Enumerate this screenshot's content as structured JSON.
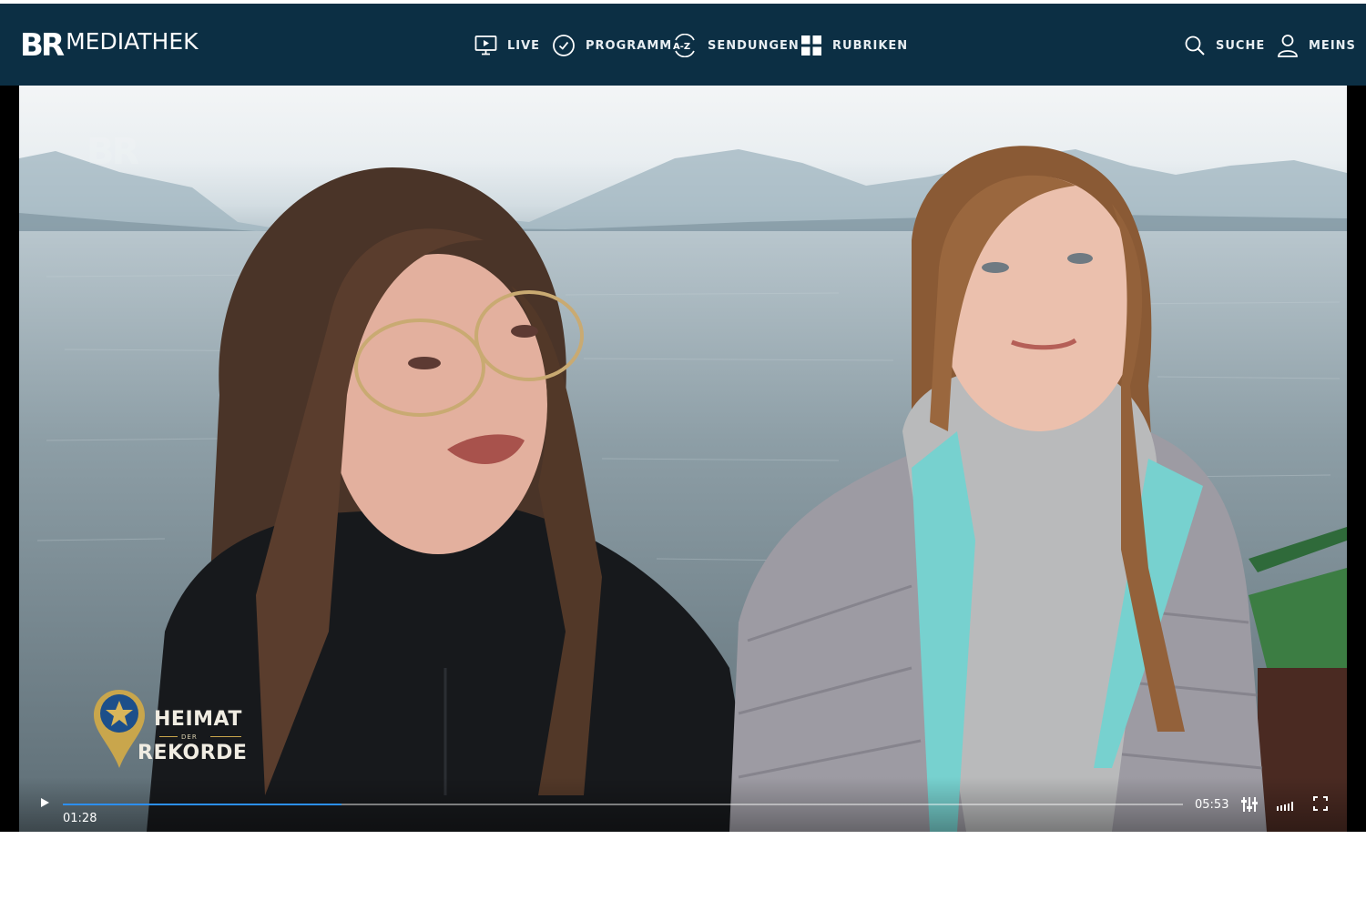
{
  "brand": {
    "logo_mark": "BR",
    "logo_text": "MEDIATHEK"
  },
  "nav": {
    "live": {
      "label": "LIVE",
      "icon": "tv-play-icon"
    },
    "programm": {
      "label": "PROGRAMM",
      "icon": "clock-icon"
    },
    "sendungen": {
      "label": "SENDUNGEN",
      "icon": "a-z-icon"
    },
    "rubriken": {
      "label": "RUBRIKEN",
      "icon": "grid-icon"
    },
    "suche": {
      "label": "SUCHE",
      "icon": "search-icon"
    },
    "meins": {
      "label": "MEINS",
      "icon": "user-icon"
    }
  },
  "video": {
    "watermark": "BR",
    "show_logo": {
      "line1": "HEIMAT",
      "line2": "DER",
      "line3": "REKORDE"
    }
  },
  "player": {
    "current_time": "01:28",
    "duration": "05:53",
    "progress": 0.249,
    "controls": [
      "play-icon",
      "settings-sliders-icon",
      "volume-icon",
      "fullscreen-icon"
    ]
  },
  "colors": {
    "header_bg": "#0c2f44",
    "progress_fill": "#2c8ff0",
    "show_logo_gold": "#c9a64c",
    "show_logo_blue": "#1d4f8a"
  }
}
